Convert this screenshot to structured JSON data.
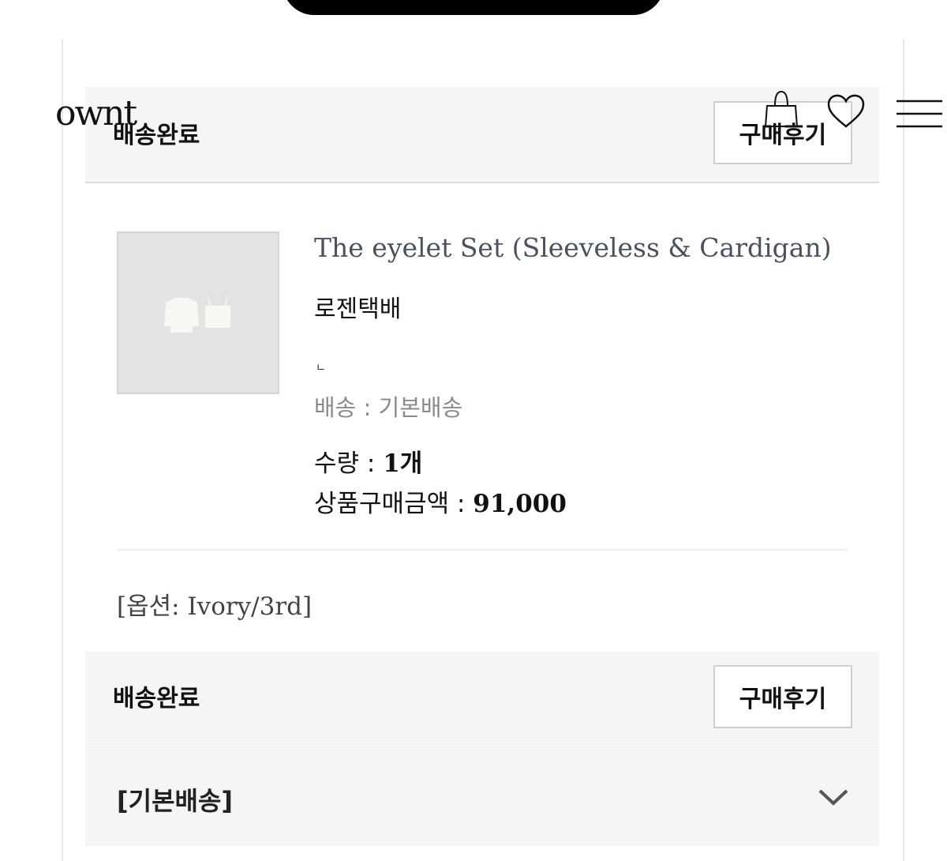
{
  "header": {
    "logo": "ownt",
    "icons": [
      "shopping-bag-icon",
      "heart-icon",
      "hamburger-menu-icon"
    ]
  },
  "order_item_1": {
    "status": "배송완료",
    "review_button": "구매후기",
    "product_name": "The eyelet Set (Sleeveless & Cardigan)",
    "carrier": "로젠택배",
    "mark": "ㄴ",
    "shipping_type": "배송 : 기본배송",
    "quantity_label": "수량 : ",
    "quantity_value": "1개",
    "price_label": "상품구매금액 : ",
    "price_value": "91,000",
    "option": "[옵션: Ivory/3rd]"
  },
  "order_item_2": {
    "status": "배송완료",
    "review_button": "구매후기"
  },
  "shipping_group": {
    "label": "[기본배송]"
  },
  "colors": {
    "status_bar_bg": "#f5f5f5",
    "product_name": "#4a5160",
    "muted_text": "#8a8a8a"
  }
}
